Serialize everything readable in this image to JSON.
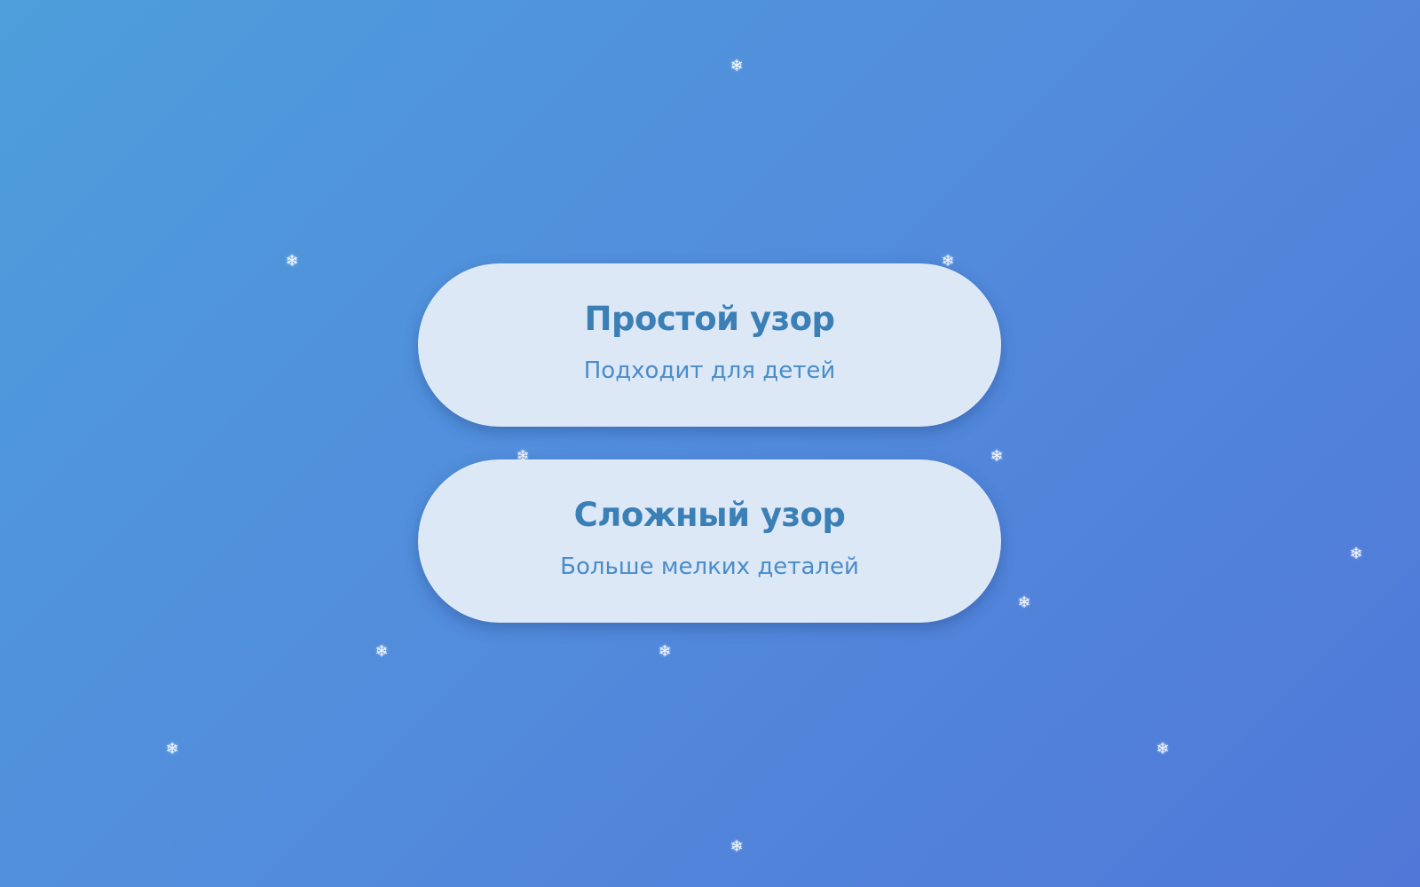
{
  "options": [
    {
      "title": "Простой узор",
      "subtitle": "Подходит для детей"
    },
    {
      "title": "Сложный узор",
      "subtitle": "Больше мелких деталей"
    }
  ],
  "decorations": {
    "snowflake_glyph": "❄",
    "snowflake_icon": "snowflake-icon"
  },
  "colors": {
    "background_start": "#4d9edb",
    "background_end": "#5078d8",
    "card": "#dde8f7",
    "title": "#3a7fb5",
    "subtitle": "#4a8cc9"
  }
}
